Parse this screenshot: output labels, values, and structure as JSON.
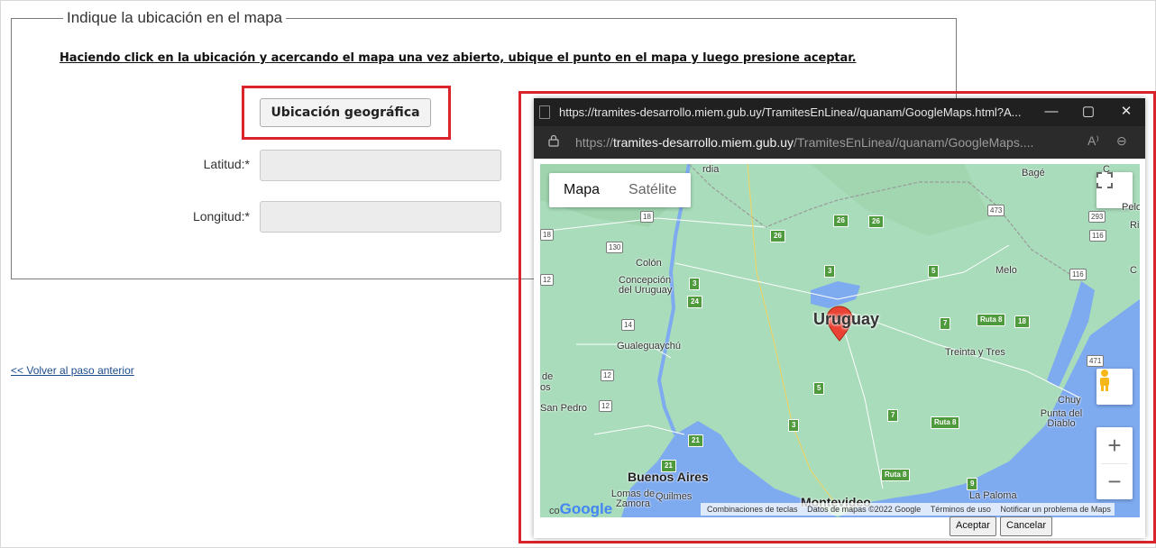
{
  "form": {
    "legend": "Indique la ubicación en el mapa",
    "instruction": "Haciendo click en la ubicación y acercando el mapa una vez abierto, ubique el punto en el mapa y luego presione aceptar.",
    "geo_button": "Ubicación geográfica",
    "latitude_label": "Latitud:*",
    "longitude_label": "Longitud:*",
    "latitude_value": "",
    "longitude_value": ""
  },
  "back_link": "<< Volver al paso anterior",
  "popup": {
    "title": "https://tramites-desarrollo.miem.gub.uy/TramitesEnLinea//quanam/GoogleMaps.html?A...",
    "url_scheme": "https://",
    "url_host": "tramites-desarrollo.miem.gub.uy",
    "url_path": "/TramitesEnLinea//quanam/GoogleMaps....",
    "minimize": "—",
    "maximize": "▢",
    "close": "✕",
    "read_aloud": "A⁾",
    "zoom_icon_glyph": "⊖",
    "map": {
      "type_map": "Mapa",
      "type_satellite": "Satélite",
      "country": "Uruguay",
      "cities": [
        "Bagé",
        "Pelo",
        "Melo",
        "Colón",
        "Concepción del Uruguay",
        "Gualeguaychú",
        "Treinta y Tres",
        "Chuy",
        "Punta del Diablo",
        "San Pedro",
        "Buenos Aires",
        "Lomas de Zamora",
        "Quilmes",
        "Montevideo",
        "La Paloma"
      ],
      "shields": [
        "18",
        "473",
        "293",
        "18",
        "130",
        "116",
        "116",
        "12",
        "14",
        "471",
        "12",
        "12"
      ],
      "green_routes": [
        "26",
        "26",
        "26",
        "3",
        "24",
        "3",
        "5",
        "7",
        "Ruta 8",
        "18",
        "5",
        "7",
        "Ruta 8",
        "3",
        "21",
        "21",
        "Ruta 8",
        "9"
      ],
      "edge_labels": [
        "rdia",
        "C",
        "Ri",
        "C",
        "de",
        "os"
      ],
      "google": "Google",
      "google_prefix": "co",
      "footer": [
        "Combinaciones de teclas",
        "Datos de mapas ©2022 Google",
        "Términos de uso",
        "Notificar un problema de Maps"
      ],
      "zoom_in": "+",
      "zoom_out": "−"
    },
    "accept": "Aceptar",
    "cancel": "Cancelar"
  },
  "colors": {
    "highlight": "#d9242c",
    "titlebar": "#202020",
    "map_land": "#a9dcbb",
    "map_water": "#7eaaf0"
  }
}
